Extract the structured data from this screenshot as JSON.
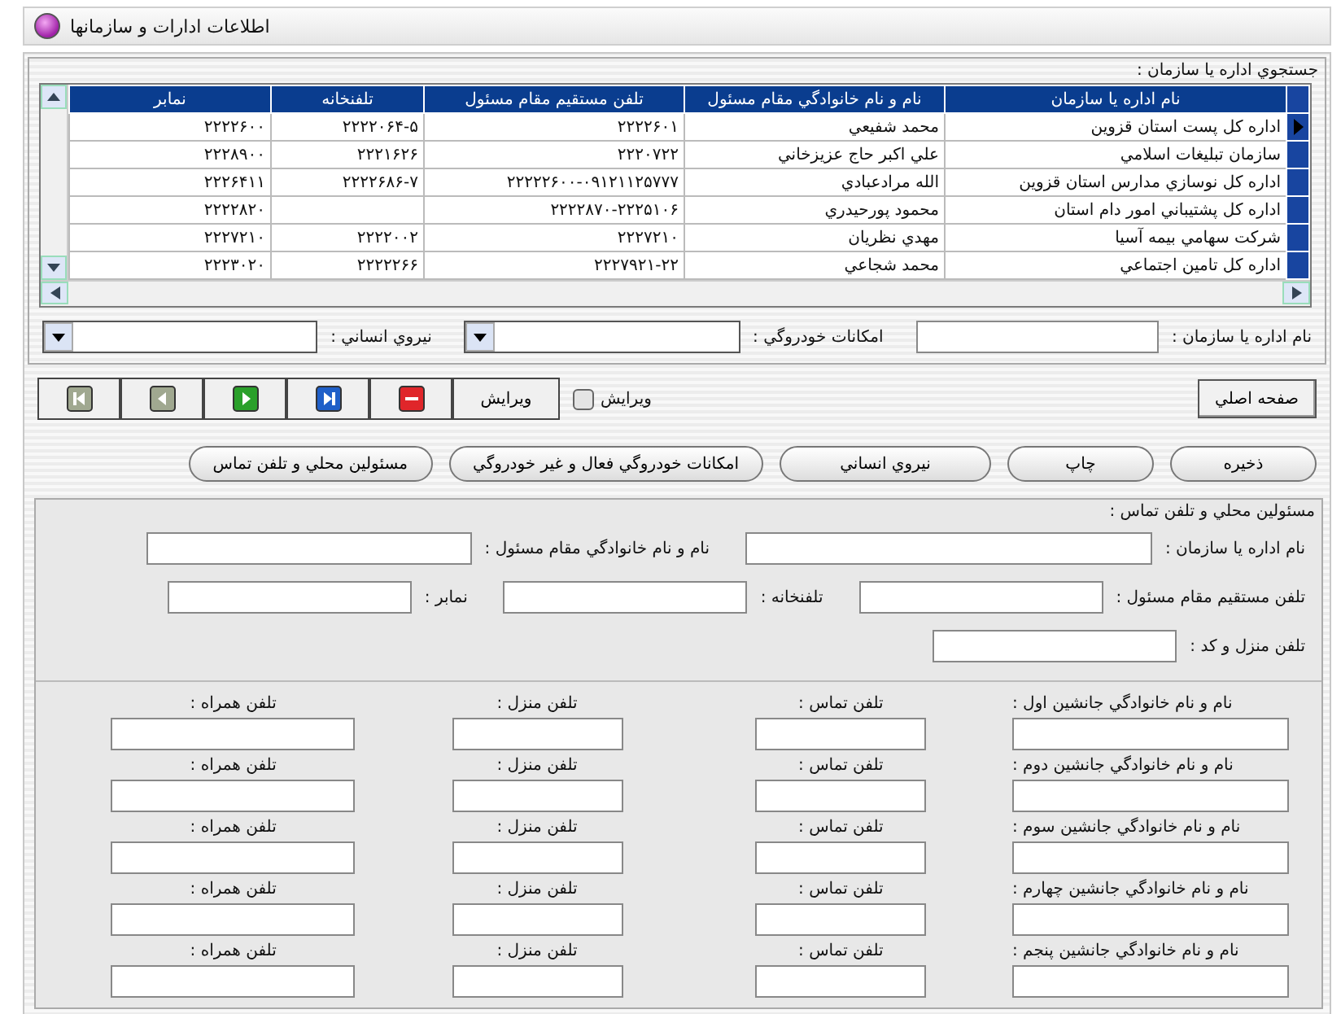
{
  "window": {
    "title": "اطلاعات ادارات و سازمانها"
  },
  "search": {
    "title": "جستجوي اداره يا سازمان :",
    "table": {
      "columns": [
        "نام اداره يا سازمان",
        "نام و نام خانوادگي مقام مسئول",
        "تلفن مستقيم مقام مسئول",
        "تلفنخانه",
        "نمابر"
      ],
      "rows": [
        {
          "selected": true,
          "cells": [
            "اداره کل پست استان قزوين",
            "محمد شفيعي",
            "۲۲۲۲۶۰۱",
            "۲۲۲۲۰۶۴-۵",
            "۲۲۲۲۶۰۰"
          ]
        },
        {
          "selected": false,
          "cells": [
            "سازمان تبليغات اسلامي",
            "علي اکبر حاج عزيزخاني",
            "۲۲۲۰۷۲۲",
            "۲۲۲۱۶۲۶",
            "۲۲۲۸۹۰۰"
          ]
        },
        {
          "selected": false,
          "cells": [
            "اداره کل نوسازي مدارس استان قزوين",
            "الله مرادعبادي",
            "۲۲۲۲۲۶۰۰-۰۹۱۲۱۱۲۵۷۷۷",
            "۲۲۲۲۶۸۶-۷",
            "۲۲۲۶۴۱۱"
          ]
        },
        {
          "selected": false,
          "cells": [
            "اداره کل پشتيباني امور دام استان",
            "محمود پورحيدري",
            "۲۲۲۲۸۷۰-۲۲۲۵۱۰۶",
            null,
            "۲۲۲۲۸۲۰"
          ]
        },
        {
          "selected": false,
          "cells": [
            "شرکت سهامي بيمه آسيا",
            "مهدي نظريان",
            "۲۲۲۷۲۱۰",
            "۲۲۲۲۰۰۲",
            "۲۲۲۷۲۱۰"
          ]
        },
        {
          "selected": false,
          "cells": [
            "اداره کل تامين اجتماعي",
            "محمد شجاعي",
            "۲۲۲۷۹۲۱-۲۲",
            "۲۲۲۲۲۶۶",
            "۲۲۲۳۰۲۰"
          ]
        }
      ]
    },
    "filters": [
      {
        "kind": "text",
        "label": "نام اداره يا سازمان :"
      },
      {
        "kind": "dropdown",
        "label": "امکانات خودروگي :"
      },
      {
        "kind": "dropdown",
        "label": "نيروي انساني :"
      }
    ]
  },
  "home_button": "صفحه اصلي",
  "edit_checkbox": {
    "label": "ويرايش",
    "checked": false
  },
  "edit_button": "ويرايش",
  "nav_buttons": [
    {
      "kind": "delete",
      "disabled": false
    },
    {
      "kind": "last",
      "disabled": false
    },
    {
      "kind": "next",
      "disabled": false
    },
    {
      "kind": "prev",
      "disabled": true
    },
    {
      "kind": "first",
      "disabled": true
    }
  ],
  "section_buttons": [
    "ذخيره",
    "چاپ",
    "نيروي انساني",
    "امکانات خودروگي فعال و غير خودروگي",
    "مسئولين محلي و تلفن تماس"
  ],
  "contacts": {
    "title": "مسئولين محلي و تلفن تماس :",
    "fields": [
      {
        "label": "نام اداره يا سازمان :"
      },
      {
        "label": "نام و نام خانوادگي مقام مسئول :"
      },
      {
        "label": "تلفن مستقيم مقام مسئول :"
      },
      {
        "label": "تلفنخانه :"
      },
      {
        "label": "نمابر :"
      },
      {
        "label": "تلفن منزل و کد :"
      }
    ],
    "successors": [
      {
        "name": "نام و نام خانوادگي جانشين اول :",
        "contact": "تلفن تماس :",
        "home": "تلفن منزل :",
        "mobile": "تلفن همراه :"
      },
      {
        "name": "نام و نام خانوادگي جانشين دوم :",
        "contact": "تلفن تماس :",
        "home": "تلفن منزل :",
        "mobile": "تلفن همراه :"
      },
      {
        "name": "نام و نام خانوادگي جانشين سوم :",
        "contact": "تلفن تماس :",
        "home": "تلفن منزل :",
        "mobile": "تلفن همراه :"
      },
      {
        "name": "نام و نام خانوادگي جانشين چهارم :",
        "contact": "تلفن تماس :",
        "home": "تلفن منزل :",
        "mobile": "تلفن همراه :"
      },
      {
        "name": "نام و نام خانوادگي جانشين پنجم :",
        "contact": "تلفن تماس :",
        "home": "تلفن منزل :",
        "mobile": "تلفن همراه :"
      }
    ]
  }
}
